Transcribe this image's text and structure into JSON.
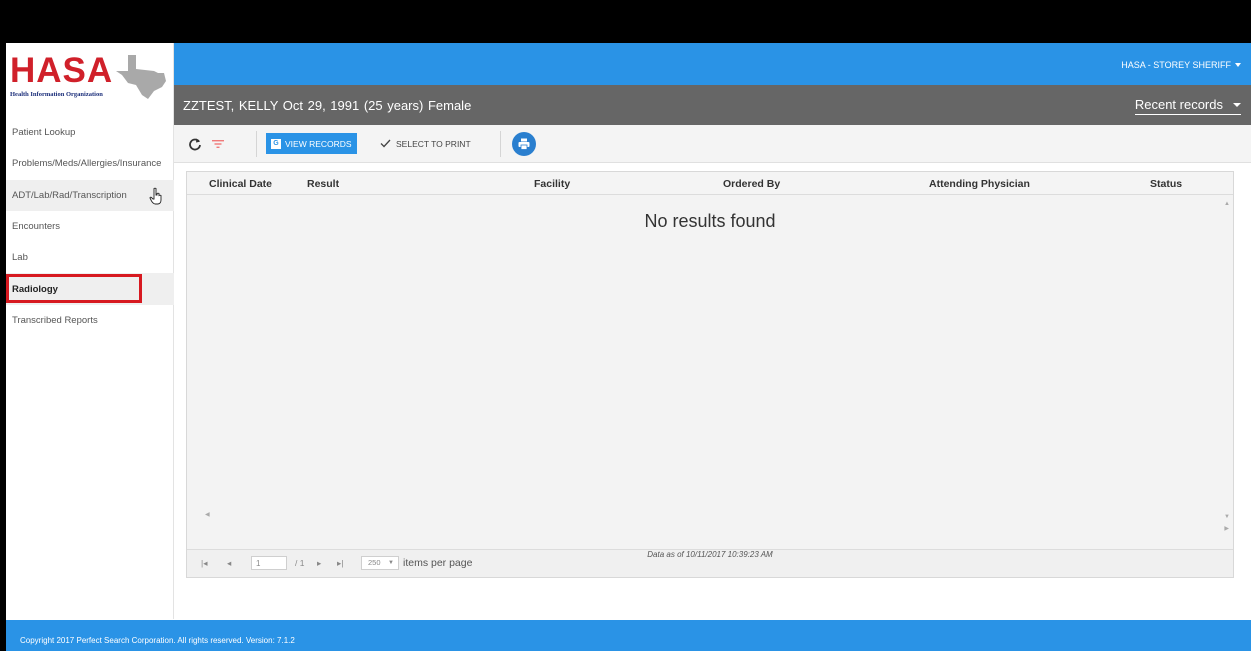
{
  "brand": {
    "logo_text": "HASA",
    "logo_subtitle": "Health Information Organization",
    "colors": {
      "primary_blue": "#2a93e6",
      "logo_red": "#d0202a",
      "highlight_red": "#d71920",
      "patient_bar": "#666666"
    }
  },
  "header": {
    "user_menu": "HASA - STOREY SHERIFF"
  },
  "patient": {
    "info": "ZZTEST, KELLY  Oct 29, 1991  (25 years)  Female",
    "recent_records": "Recent records"
  },
  "sidebar": {
    "items": [
      {
        "label": "Patient Lookup"
      },
      {
        "label": "Problems/Meds/Allergies/Insurance"
      },
      {
        "label": "ADT/Lab/Rad/Transcription"
      },
      {
        "label": "Encounters"
      },
      {
        "label": "Lab"
      },
      {
        "label": "Radiology"
      },
      {
        "label": "Transcribed Reports"
      }
    ]
  },
  "toolbar": {
    "view_records": "VIEW RECORDS",
    "view_records_icon_letter": "G",
    "select_to_print": "SELECT TO PRINT",
    "icons": [
      "refresh-icon",
      "filter-icon",
      "check-icon",
      "print-icon"
    ]
  },
  "grid": {
    "columns": [
      "Clinical Date",
      "Result",
      "Facility",
      "Ordered By",
      "Attending Physician",
      "Status"
    ],
    "empty_message": "No results found"
  },
  "pager": {
    "first": "|◂",
    "prev": "◂",
    "page_value": "1",
    "of_pages": "/ 1",
    "next": "▸",
    "last": "▸|",
    "page_size": "250",
    "items_per_page": "items per page"
  },
  "data_as_of": "Data as of 10/11/2017 10:39:23 AM",
  "footer": {
    "copyright": "Copyright 2017 Perfect Search Corporation. All rights reserved. Version: 7.1.2"
  }
}
